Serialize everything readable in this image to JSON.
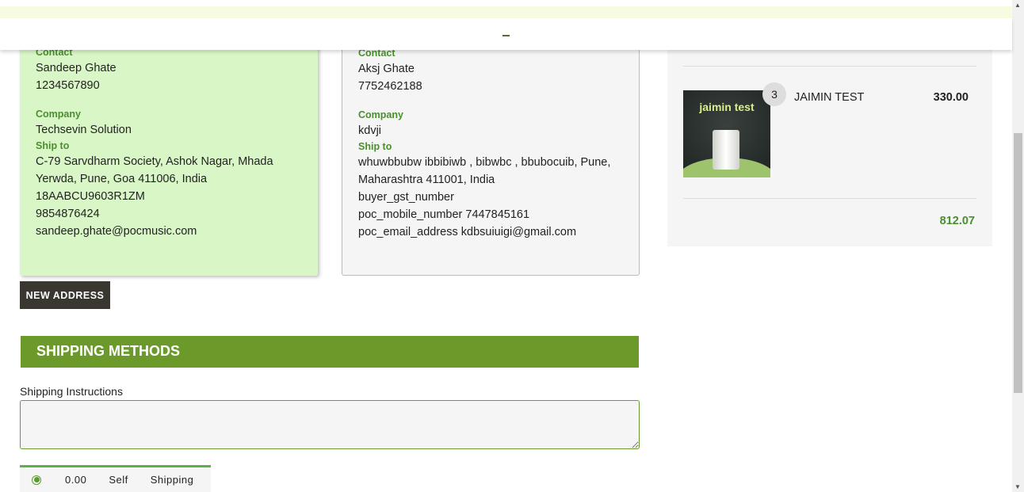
{
  "selected_address": {
    "contact_label": "Contact",
    "name": "Sandeep Ghate",
    "phone": "1234567890",
    "company_label": "Company",
    "company": "Techsevin Solution",
    "shipto_label": "Ship to",
    "lines": [
      "C-79 Sarvdharm Society, Ashok Nagar, Mhada",
      "Yerwda, Pune, Goa 411006, India",
      "18AABCU9603R1ZM",
      "9854876424",
      "sandeep.ghate@pocmusic.com"
    ]
  },
  "other_address": {
    "contact_label": "Contact",
    "name": "Aksj Ghate",
    "phone": "7752462188",
    "company_label": "Company",
    "company": "kdvji",
    "shipto_label": "Ship to",
    "lines": [
      "whuwbbubw ibbibiwb , bibwbc , bbubocuib, Pune,",
      "Maharashtra 411001, India",
      "buyer_gst_number",
      "poc_mobile_number 7447845161",
      "poc_email_address kdbsuiuigi@gmail.com"
    ]
  },
  "new_address_label": "NEW ADDRESS",
  "shipping": {
    "title": "SHIPPING METHODS",
    "instructions_label": "Shipping Instructions",
    "method": {
      "price": "0.00",
      "carrier": "Self",
      "name": "Shipping"
    }
  },
  "cart": {
    "title": "3 Items in Cart",
    "item": {
      "image_text": "jaimin test",
      "qty": "3",
      "name": "JAIMIN TEST",
      "price": "330.00"
    },
    "total": "812.07"
  }
}
